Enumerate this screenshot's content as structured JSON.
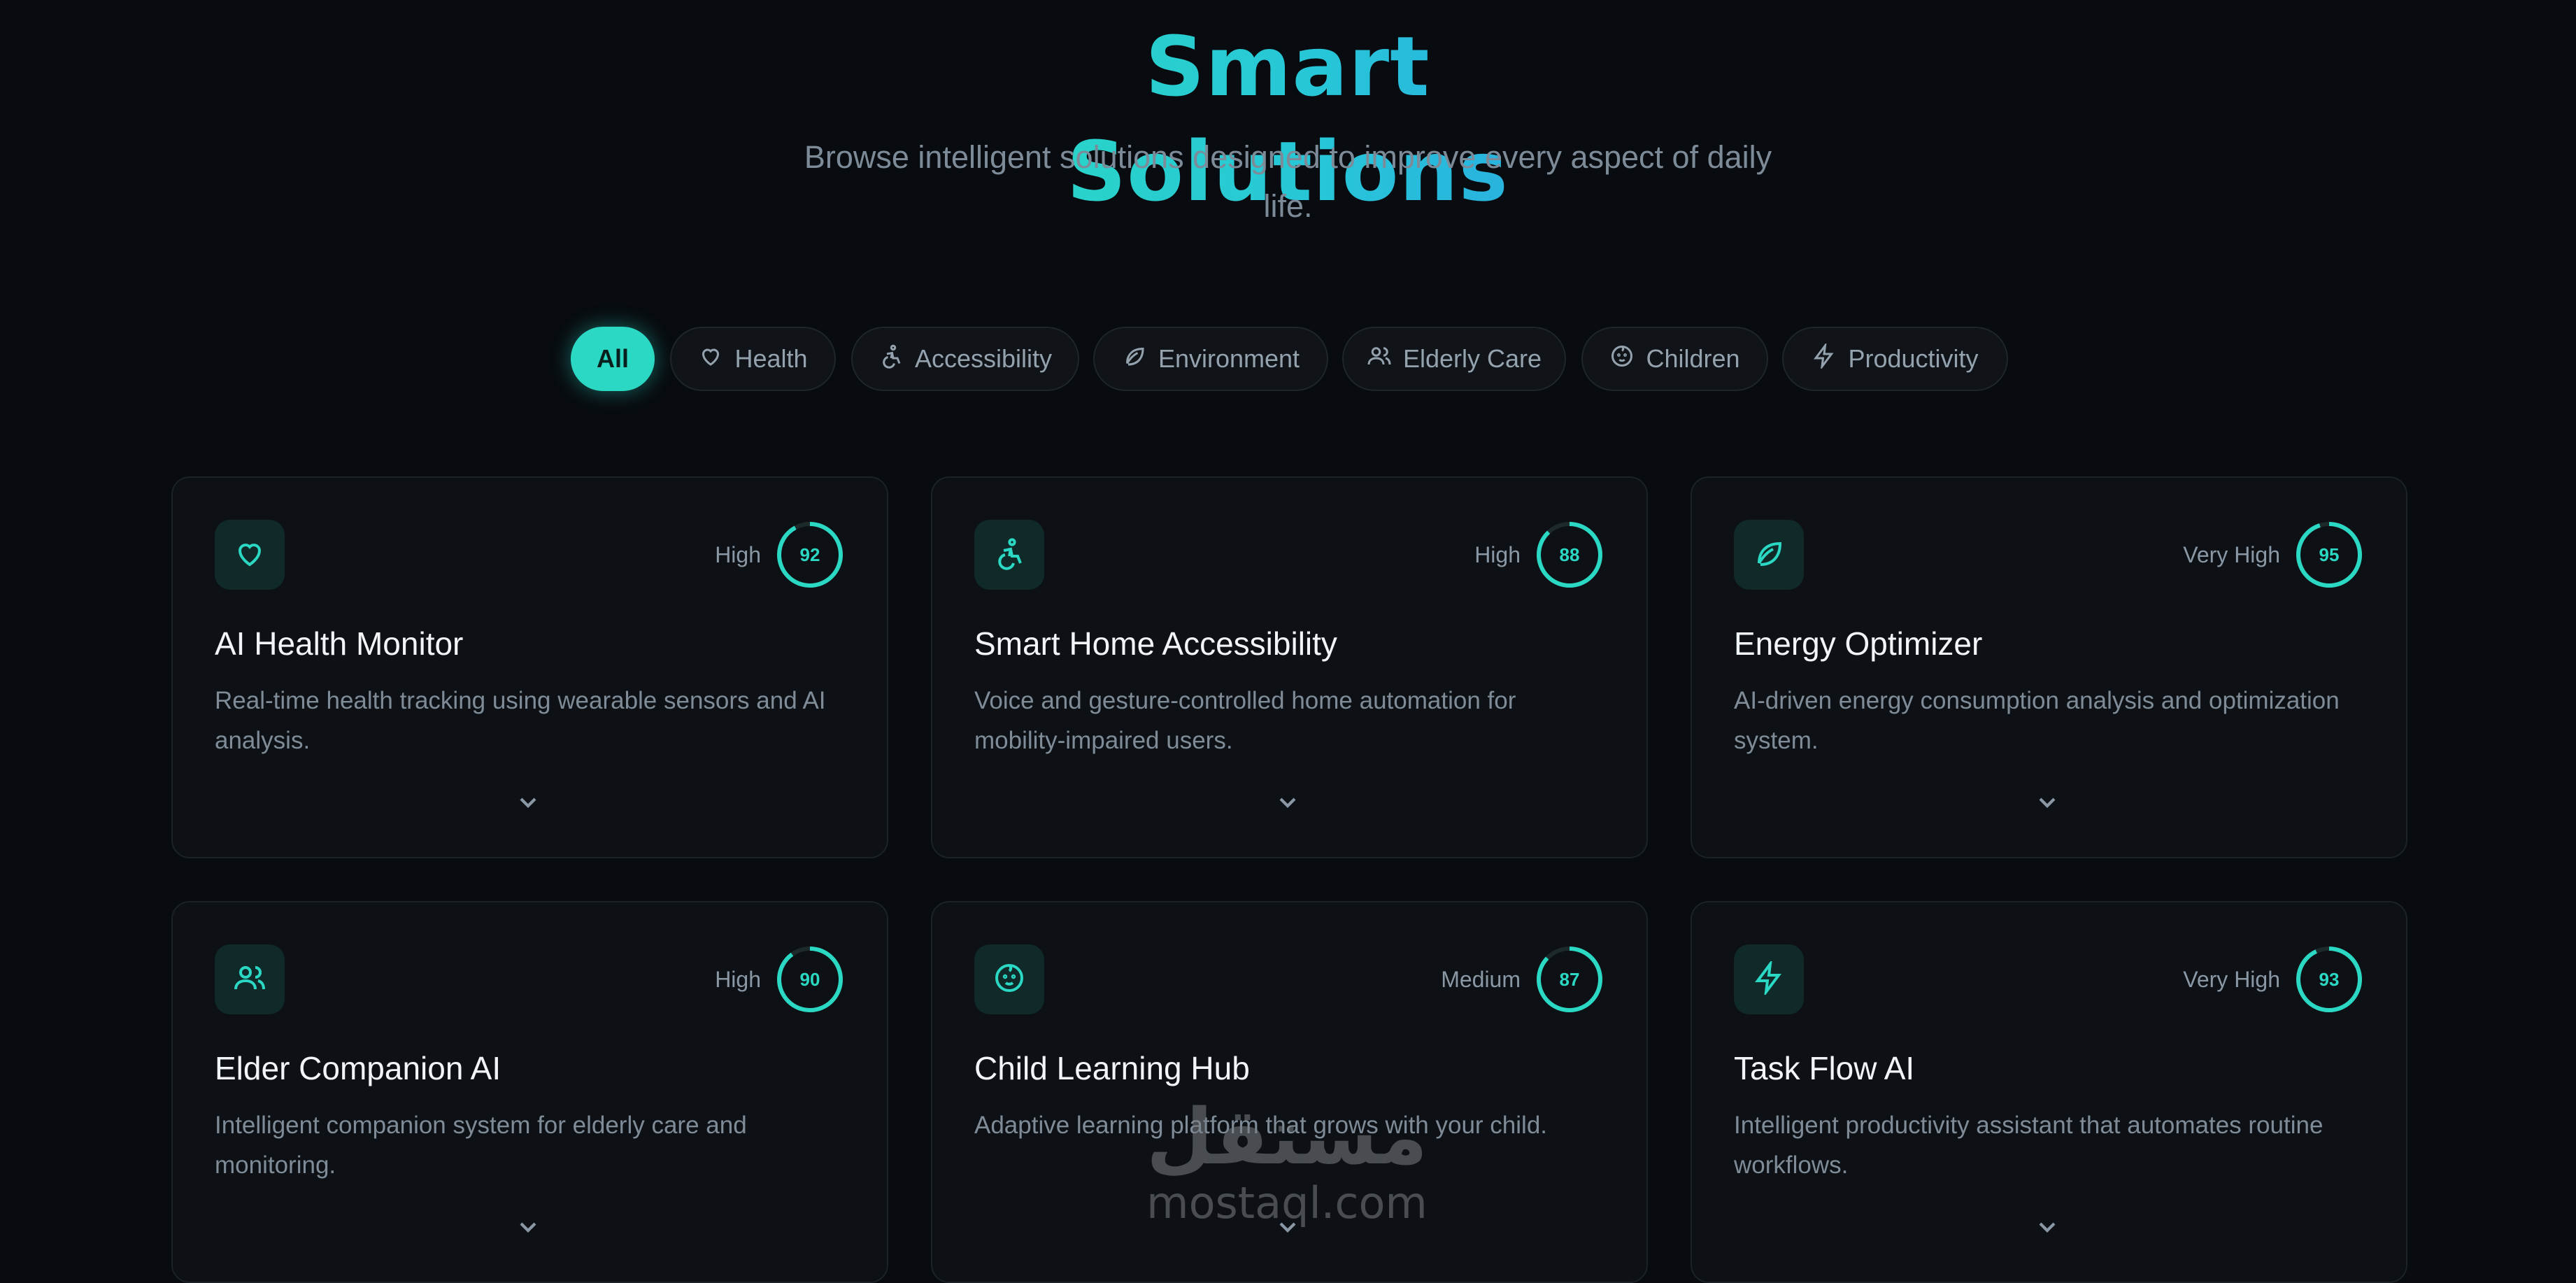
{
  "header": {
    "title": "Smart Solutions",
    "subtitle": "Browse intelligent solutions designed to improve every aspect of daily life."
  },
  "filters": [
    {
      "label": "All",
      "icon": "none",
      "active": true
    },
    {
      "label": "Health",
      "icon": "heart-icon",
      "active": false
    },
    {
      "label": "Accessibility",
      "icon": "accessibility-icon",
      "active": false
    },
    {
      "label": "Environment",
      "icon": "leaf-icon",
      "active": false
    },
    {
      "label": "Elderly Care",
      "icon": "users-icon",
      "active": false
    },
    {
      "label": "Children",
      "icon": "baby-icon",
      "active": false
    },
    {
      "label": "Productivity",
      "icon": "lightning-icon",
      "active": false
    }
  ],
  "cards": [
    {
      "title": "AI Health Monitor",
      "desc": "Real-time health tracking using wearable sensors and AI analysis.",
      "level": "High",
      "score": 92,
      "icon": "heart-icon"
    },
    {
      "title": "Smart Home Accessibility",
      "desc": "Voice and gesture-controlled home automation for mobility-impaired users.",
      "level": "High",
      "score": 88,
      "icon": "accessibility-icon"
    },
    {
      "title": "Energy Optimizer",
      "desc": "AI-driven energy consumption analysis and optimization system.",
      "level": "Very High",
      "score": 95,
      "icon": "leaf-icon"
    },
    {
      "title": "Elder Companion AI",
      "desc": "Intelligent companion system for elderly care and monitoring.",
      "level": "High",
      "score": 90,
      "icon": "users-icon"
    },
    {
      "title": "Child Learning Hub",
      "desc": "Adaptive learning platform that grows with your child.",
      "level": "Medium",
      "score": 87,
      "icon": "baby-icon"
    },
    {
      "title": "Task Flow AI",
      "desc": "Intelligent productivity assistant that automates routine workflows.",
      "level": "Very High",
      "score": 93,
      "icon": "lightning-icon"
    }
  ],
  "watermark": {
    "arabic": "مستقل",
    "latin": "mostaql.com"
  },
  "colors": {
    "accent": "#2ad8c3",
    "background": "#080b0f",
    "card": "#0d1115"
  }
}
